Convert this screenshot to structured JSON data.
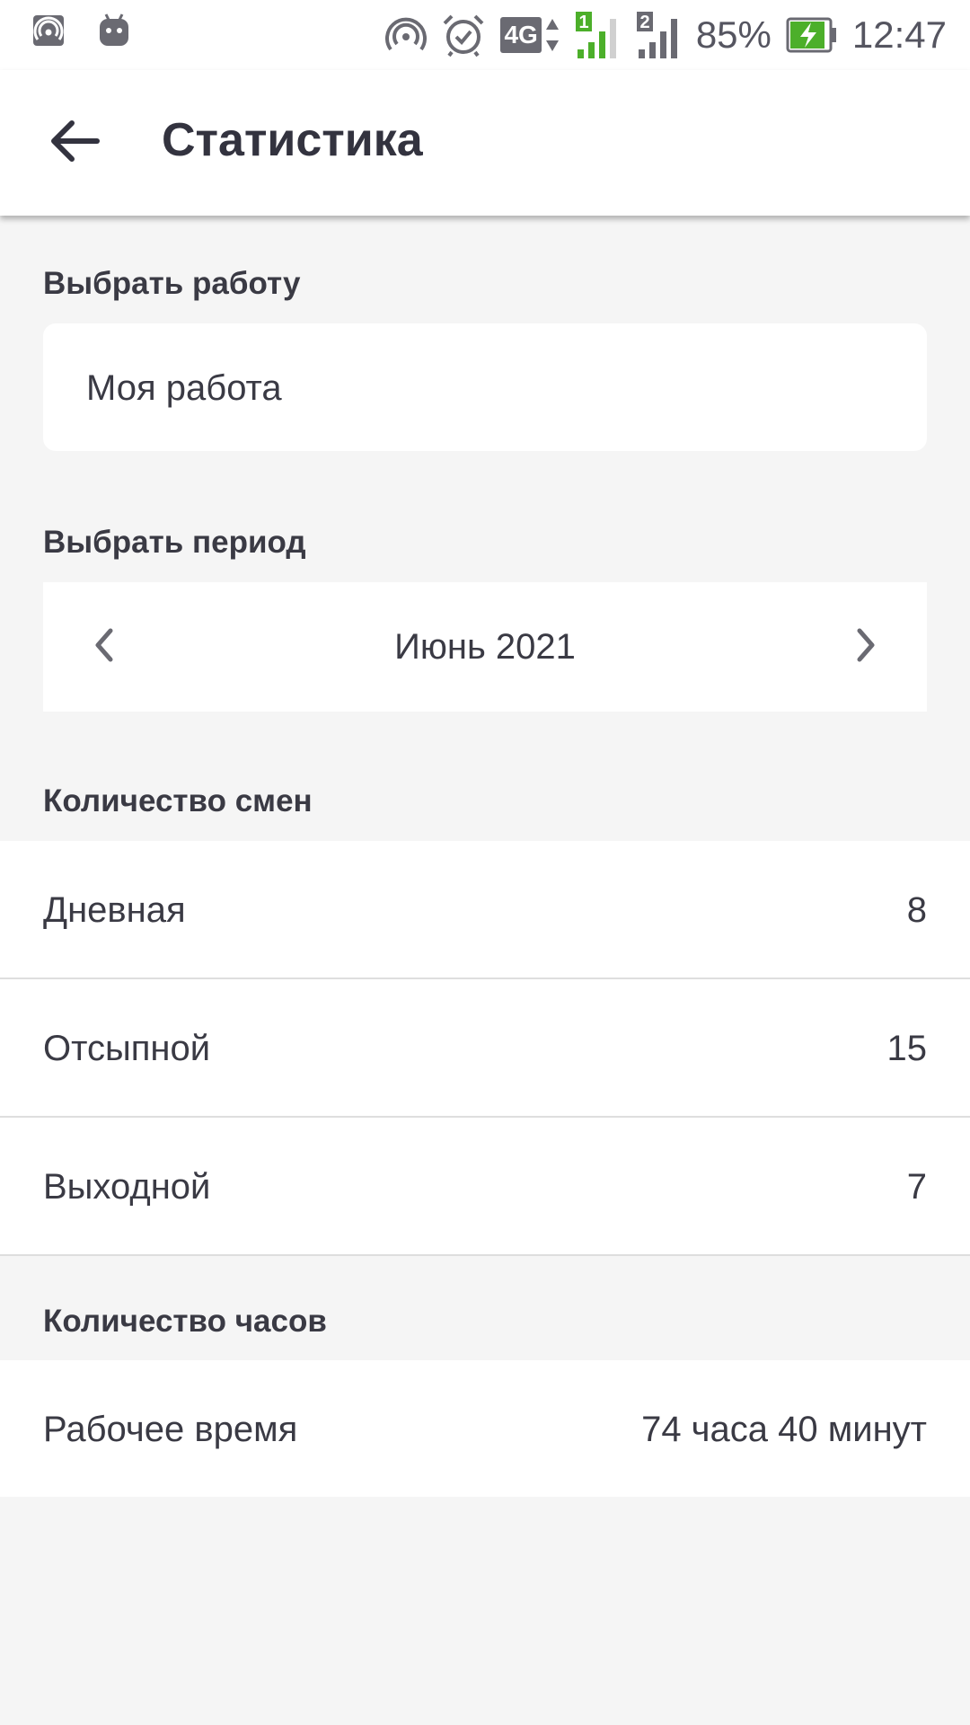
{
  "status_bar": {
    "battery": "85%",
    "time": "12:47",
    "network": "4G",
    "sim1": "1",
    "sim2": "2",
    "battery_color": "#4caf2a",
    "icons": [
      "hotspot-icon",
      "android-icon",
      "nfc-icon",
      "alarm-icon",
      "4g-icon",
      "signal-sim1-icon",
      "signal-sim2-icon",
      "battery-charging-icon"
    ]
  },
  "app_bar": {
    "title": "Статистика",
    "back_icon": "arrow-back-icon"
  },
  "job_section": {
    "label": "Выбрать работу",
    "value": "Моя работа"
  },
  "period_section": {
    "label": "Выбрать период",
    "value": "Июнь 2021",
    "prev_icon": "chevron-left-icon",
    "next_icon": "chevron-right-icon"
  },
  "shifts_section": {
    "label": "Количество смен",
    "rows": [
      {
        "label": "Дневная",
        "value": "8"
      },
      {
        "label": "Отсыпной",
        "value": "15"
      },
      {
        "label": "Выходной",
        "value": "7"
      }
    ]
  },
  "hours_section": {
    "label": "Количество часов",
    "rows": [
      {
        "label": "Рабочее время",
        "value": "74 часа 40 минут"
      }
    ]
  },
  "colors": {
    "background": "#f5f5f5",
    "surface": "#ffffff",
    "text": "#3a3a44",
    "divider": "#dedede"
  }
}
